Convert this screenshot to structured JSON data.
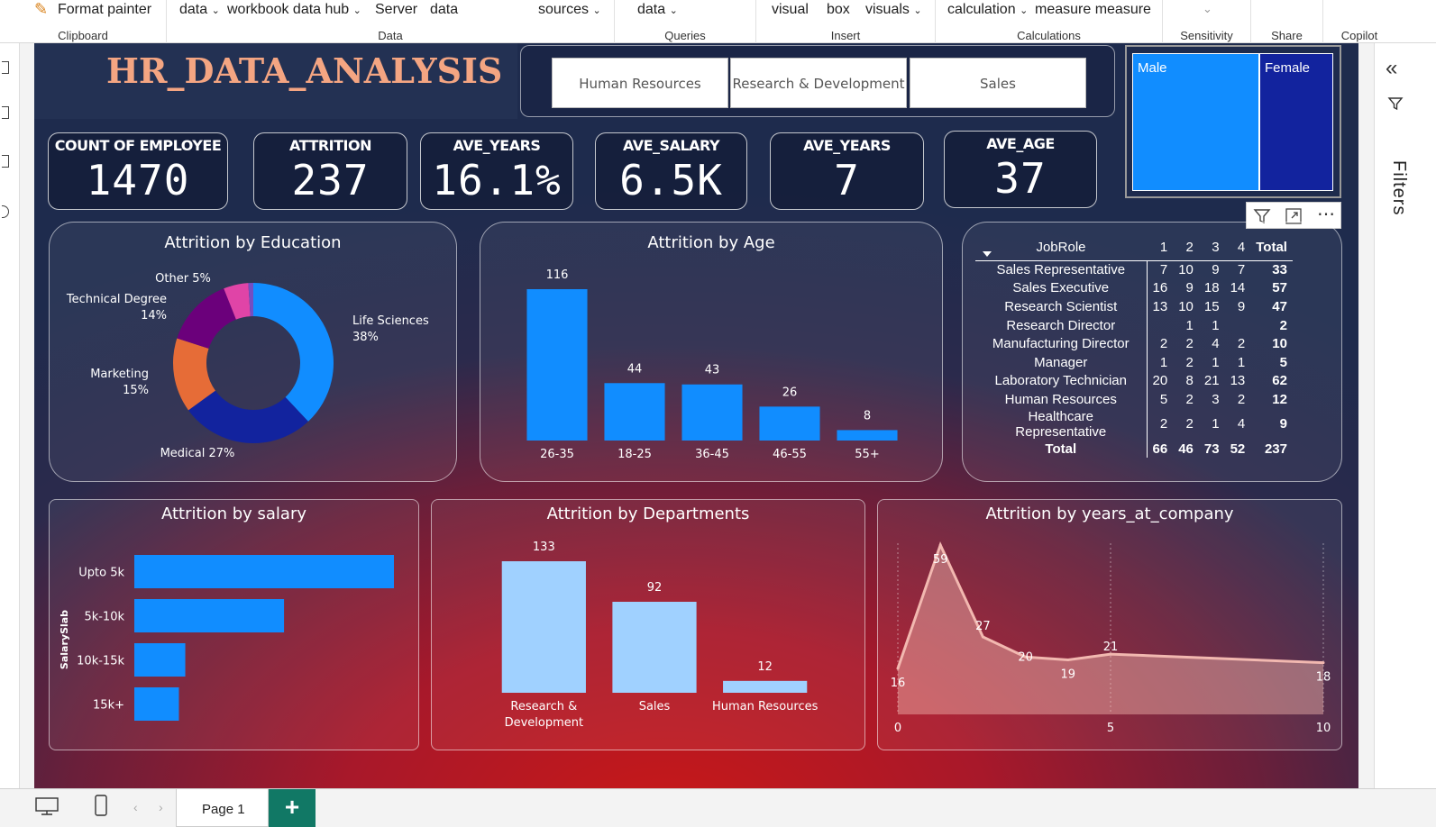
{
  "ribbon": {
    "groups": [
      {
        "label": "Clipboard",
        "items": [
          "Format painter"
        ]
      },
      {
        "label": "Data",
        "items": [
          "data",
          "workbook data hub",
          "Server",
          "data",
          "sources"
        ]
      },
      {
        "label": "Queries",
        "items": [
          "data"
        ]
      },
      {
        "label": "Insert",
        "items": [
          "visual",
          "box",
          "visuals"
        ]
      },
      {
        "label": "Calculations",
        "items": [
          "calculation",
          "measure measure"
        ]
      },
      {
        "label": "Sensitivity",
        "items": [
          ""
        ]
      },
      {
        "label": "Share",
        "items": []
      },
      {
        "label": "Copilot",
        "items": []
      }
    ]
  },
  "report": {
    "title": "HR_DATA_ANALYSIS",
    "department_slicer": [
      "Human Resources",
      "Research & Development",
      "Sales"
    ],
    "gender_slicer": [
      "Male",
      "Female"
    ],
    "kpis": [
      {
        "label": "COUNT OF EMPLOYEE",
        "value": "1470"
      },
      {
        "label": "ATTRITION",
        "value": "237"
      },
      {
        "label": "AVE_YEARS",
        "value": "16.1%"
      },
      {
        "label": "AVE_SALARY",
        "value": "6.5K"
      },
      {
        "label": "AVE_YEARS",
        "value": "7"
      },
      {
        "label": "AVE_AGE",
        "value": "37"
      }
    ],
    "visual_toolbar": [
      "filter-icon",
      "focus-mode-icon",
      "more-options-icon"
    ],
    "matrix": {
      "headers": [
        "JobRole",
        "1",
        "2",
        "3",
        "4",
        "Total"
      ],
      "rows": [
        [
          "Sales Representative",
          "7",
          "10",
          "9",
          "7",
          "33"
        ],
        [
          "Sales Executive",
          "16",
          "9",
          "18",
          "14",
          "57"
        ],
        [
          "Research Scientist",
          "13",
          "10",
          "15",
          "9",
          "47"
        ],
        [
          "Research Director",
          "",
          "1",
          "1",
          "",
          "2"
        ],
        [
          "Manufacturing Director",
          "2",
          "2",
          "4",
          "2",
          "10"
        ],
        [
          "Manager",
          "1",
          "2",
          "1",
          "1",
          "5"
        ],
        [
          "Laboratory Technician",
          "20",
          "8",
          "21",
          "13",
          "62"
        ],
        [
          "Human Resources",
          "5",
          "2",
          "3",
          "2",
          "12"
        ],
        [
          "Healthcare Representative",
          "2",
          "2",
          "1",
          "4",
          "9"
        ]
      ],
      "total_row": [
        "Total",
        "66",
        "46",
        "73",
        "52",
        "237"
      ]
    }
  },
  "panes": {
    "filters_label": "Filters"
  },
  "footer": {
    "page_tab": "Page 1",
    "add_page": "+"
  },
  "chart_data": [
    {
      "type": "pie",
      "title": "Attrition by Education",
      "categories": [
        "Life Sciences",
        "Medical",
        "Marketing",
        "Technical Degree",
        "Other",
        "Human Resources"
      ],
      "values": [
        38,
        27,
        15,
        14,
        5,
        1
      ],
      "labels": [
        "Life Sciences\n38%",
        "Medical 27%",
        "Marketing\n15%",
        "Technical Degree\n14%",
        "Other 5%",
        ""
      ],
      "colors": [
        "#118dff",
        "#12239e",
        "#e66c37",
        "#6b007b",
        "#e044a7",
        "#744ec2"
      ],
      "donut": true
    },
    {
      "type": "bar",
      "title": "Attrition by Age",
      "categories": [
        "26-35",
        "18-25",
        "36-45",
        "46-55",
        "55+"
      ],
      "values": [
        116,
        44,
        43,
        26,
        8
      ],
      "color": "#118dff"
    },
    {
      "type": "bar",
      "orientation": "horizontal",
      "title": "Attrition by salary",
      "ylabel": "SalarySlab",
      "categories": [
        "Upto 5k",
        "5k-10k",
        "10k-15k",
        "15k+"
      ],
      "values": [
        163,
        94,
        32,
        28
      ],
      "color": "#118dff"
    },
    {
      "type": "bar",
      "title": "Attrition by Departments",
      "categories": [
        "Research & Development",
        "Sales",
        "Human Resources"
      ],
      "values": [
        133,
        92,
        12
      ],
      "color": "#a0d1ff"
    },
    {
      "type": "area",
      "title": "Attrition by years_at_company",
      "x": [
        0,
        1,
        2,
        3,
        4,
        5,
        10
      ],
      "values": [
        16,
        59,
        27,
        20,
        19,
        21,
        18
      ],
      "xticks": [
        0,
        5,
        10
      ],
      "color": "#f2b8b0"
    }
  ]
}
